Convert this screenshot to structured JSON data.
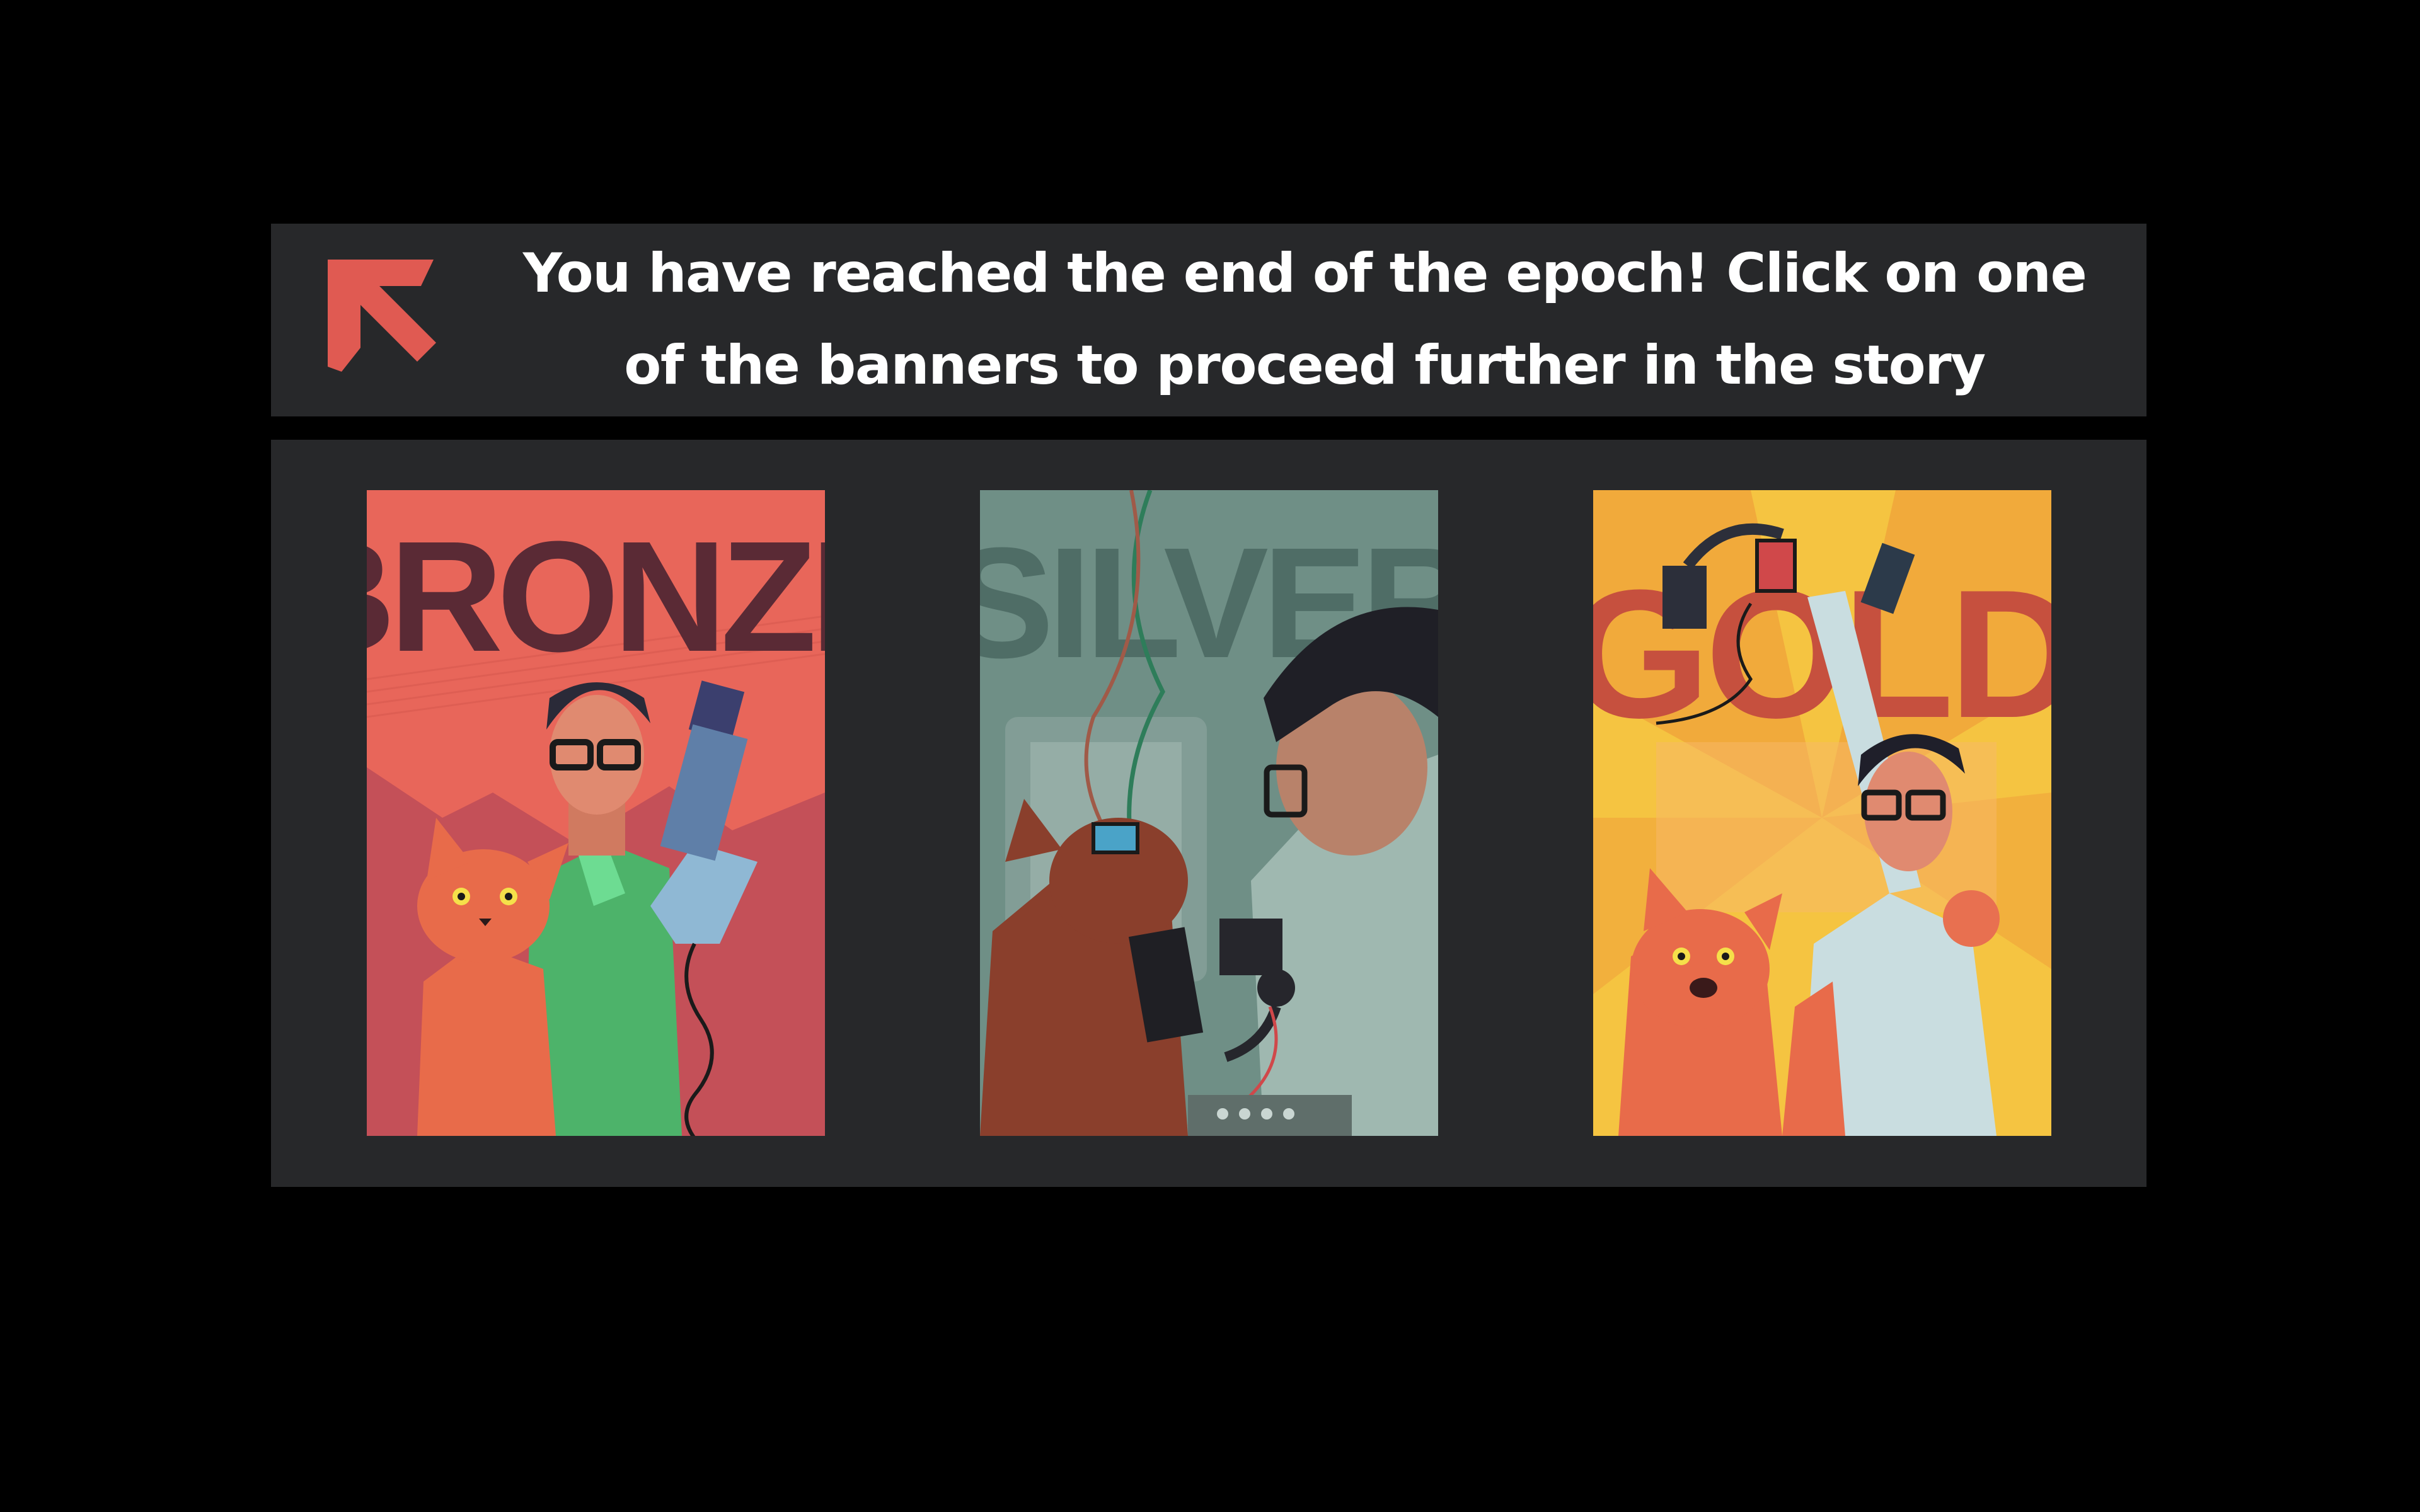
{
  "message": {
    "text": "You have reached the end of the epoch! Click on one of the banners to proceed further in the story"
  },
  "icons": {
    "arrow": "arrow-up-left-icon"
  },
  "colors": {
    "background": "#000000",
    "panel": "#27282a",
    "text": "#ffffff",
    "arrow": "#e05a52",
    "bronze": "#e8665a",
    "silver": "#6f8f86",
    "gold": "#f5c441"
  },
  "banners": [
    {
      "id": "bronze",
      "title": "BRONZE"
    },
    {
      "id": "silver",
      "title": "SILVER"
    },
    {
      "id": "gold",
      "title": "GOLD"
    }
  ]
}
